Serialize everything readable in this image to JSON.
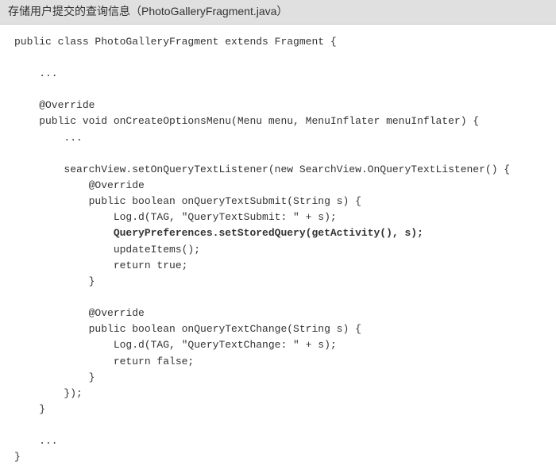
{
  "header": {
    "title": "存储用户提交的查询信息（PhotoGalleryFragment.java）"
  },
  "code": {
    "line01": "public class PhotoGalleryFragment extends Fragment {",
    "line02": "",
    "line03": "    ...",
    "line04": "",
    "line05": "    @Override",
    "line06": "    public void onCreateOptionsMenu(Menu menu, MenuInflater menuInflater) {",
    "line07": "        ...",
    "line08": "",
    "line09": "        searchView.setOnQueryTextListener(new SearchView.OnQueryTextListener() {",
    "line10": "            @Override",
    "line11": "            public boolean onQueryTextSubmit(String s) {",
    "line12": "                Log.d(TAG, \"QueryTextSubmit: \" + s);",
    "line13": "                QueryPreferences.setStoredQuery(getActivity(), s);",
    "line14": "                updateItems();",
    "line15": "                return true;",
    "line16": "            }",
    "line17": "",
    "line18": "            @Override",
    "line19": "            public boolean onQueryTextChange(String s) {",
    "line20": "                Log.d(TAG, \"QueryTextChange: \" + s);",
    "line21": "                return false;",
    "line22": "            }",
    "line23": "        });",
    "line24": "    }",
    "line25": "",
    "line26": "    ...",
    "line27": "}"
  }
}
